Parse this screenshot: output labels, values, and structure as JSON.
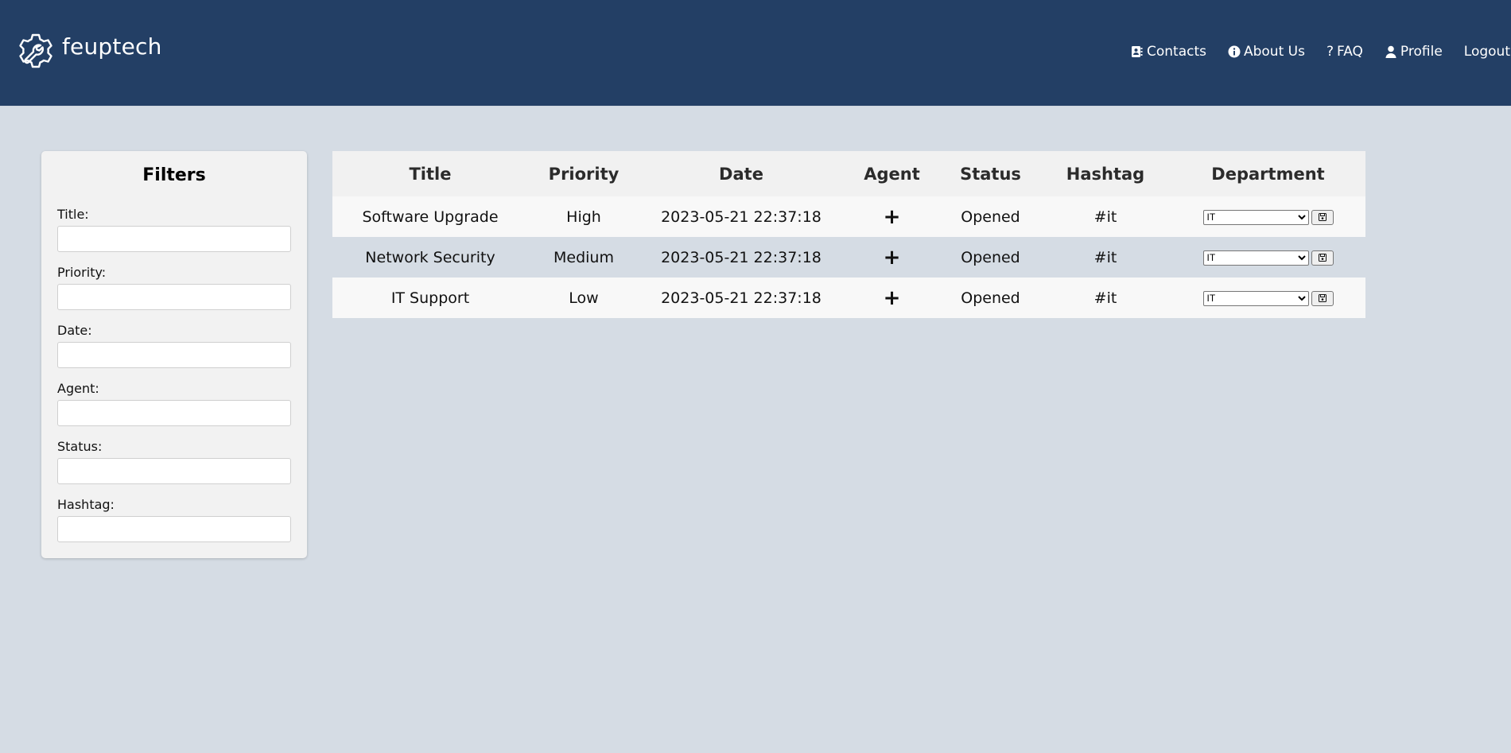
{
  "header": {
    "logo_text": "feuptech",
    "nav": [
      {
        "label": "Contacts",
        "icon": "address-book-icon"
      },
      {
        "label": "About Us",
        "icon": "info-circle-icon"
      },
      {
        "label": "FAQ",
        "icon": "question-icon"
      },
      {
        "label": "Profile",
        "icon": "user-icon"
      },
      {
        "label": "Logout",
        "icon": ""
      }
    ]
  },
  "filters": {
    "title": "Filters",
    "fields": [
      {
        "label": "Title:",
        "value": ""
      },
      {
        "label": "Priority:",
        "value": ""
      },
      {
        "label": "Date:",
        "value": ""
      },
      {
        "label": "Agent:",
        "value": ""
      },
      {
        "label": "Status:",
        "value": ""
      },
      {
        "label": "Hashtag:",
        "value": ""
      }
    ]
  },
  "table": {
    "columns": [
      "Title",
      "Priority",
      "Date",
      "Agent",
      "Status",
      "Hashtag",
      "Department"
    ],
    "rows": [
      {
        "title": "Software Upgrade",
        "priority": "High",
        "date": "2023-05-21 22:37:18",
        "agent": "+",
        "status": "Opened",
        "hashtag": "#it",
        "department": "IT"
      },
      {
        "title": "Network Security",
        "priority": "Medium",
        "date": "2023-05-21 22:37:18",
        "agent": "+",
        "status": "Opened",
        "hashtag": "#it",
        "department": "IT"
      },
      {
        "title": "IT Support",
        "priority": "Low",
        "date": "2023-05-21 22:37:18",
        "agent": "+",
        "status": "Opened",
        "hashtag": "#it",
        "department": "IT"
      }
    ]
  },
  "colors": {
    "header_bg": "#233f65",
    "page_bg": "#d5dce4",
    "panel_bg": "#f2f2f2"
  }
}
